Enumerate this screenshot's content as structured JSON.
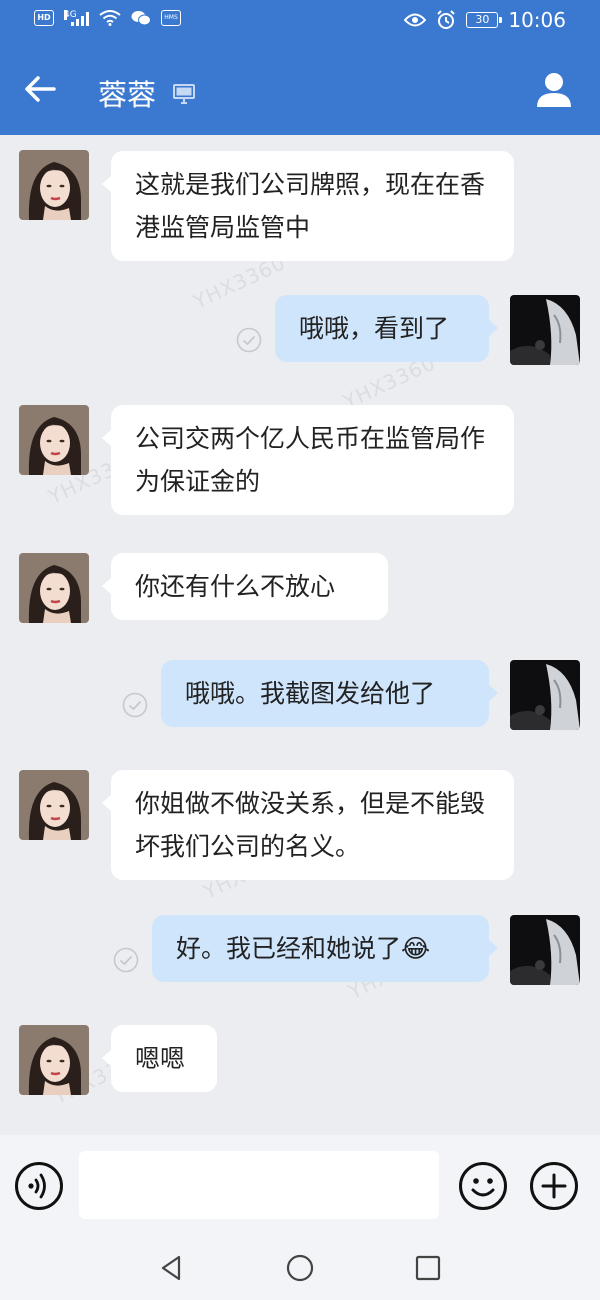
{
  "status_bar": {
    "network": "4G",
    "battery": "30",
    "time": "10:06"
  },
  "header": {
    "title": "蓉蓉"
  },
  "watermark": "YHX3360",
  "messages": [
    {
      "from": "contact",
      "text": "这就是我们公司牌照，现在在香港监管局监管中"
    },
    {
      "from": "me",
      "text": "哦哦，看到了"
    },
    {
      "from": "contact",
      "text": "公司交两个亿人民币在监管局作为保证金的"
    },
    {
      "from": "contact",
      "text": "你还有什么不放心"
    },
    {
      "from": "me",
      "text": "哦哦。我截图发给他了"
    },
    {
      "from": "contact",
      "text": "你姐做不做没关系，但是不能毁坏我们公司的名义。"
    },
    {
      "from": "me",
      "text": "好。我已经和她说了😂"
    },
    {
      "from": "contact",
      "text": "嗯嗯"
    }
  ],
  "input": {
    "value": ""
  },
  "colors": {
    "header": "#3b78cf",
    "bubble_in": "#ffffff",
    "bubble_out": "#cfe5fc",
    "background": "#ebedf0"
  }
}
